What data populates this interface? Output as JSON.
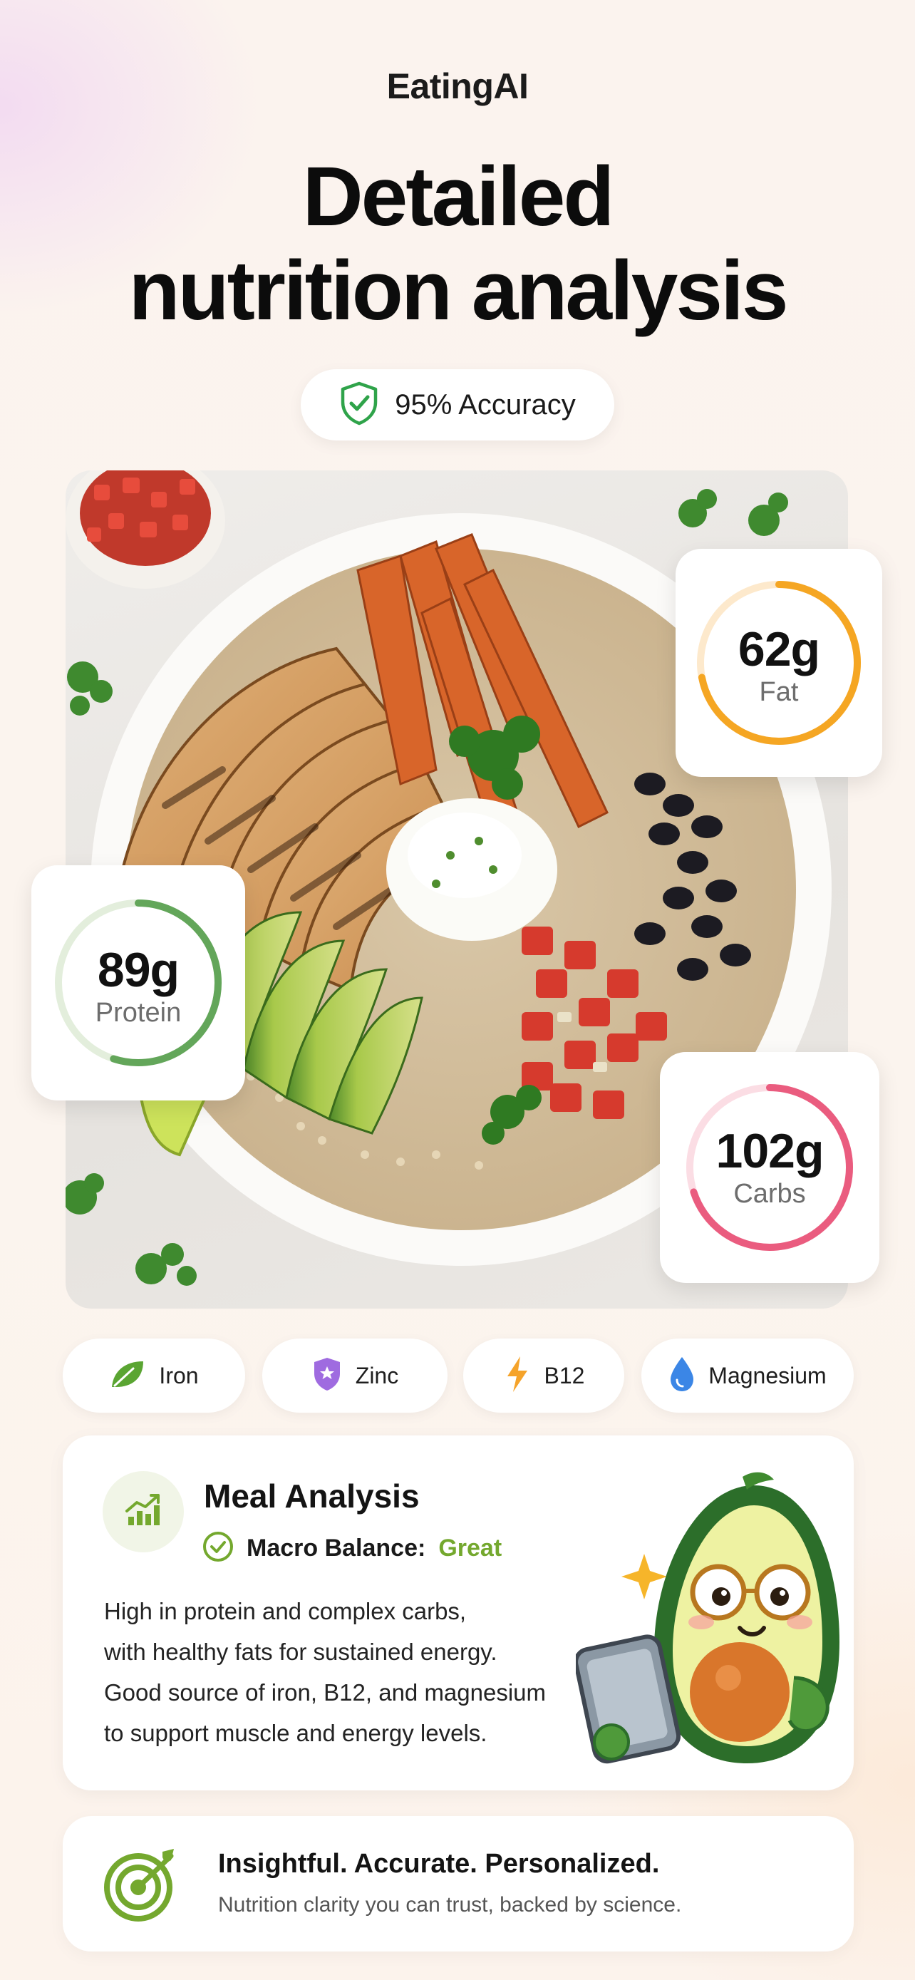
{
  "brand": "EatingAI",
  "headline": {
    "line1": "Detailed",
    "line2": "nutrition analysis"
  },
  "accuracy": {
    "label": "95% Accuracy",
    "icon": "shield-check-icon",
    "color": "#2fa34a"
  },
  "macros": {
    "fat": {
      "value": "62g",
      "label": "Fat",
      "color": "#f5a623",
      "progress": 0.72
    },
    "protein": {
      "value": "89g",
      "label": "Protein",
      "color": "#63a65a",
      "progress": 0.55
    },
    "carbs": {
      "value": "102g",
      "label": "Carbs",
      "color": "#ea5c7f",
      "progress": 0.7
    }
  },
  "nutrients": [
    {
      "label": "Iron",
      "icon": "leaf-icon",
      "color": "#5aa532"
    },
    {
      "label": "Zinc",
      "icon": "star-shield-icon",
      "color": "#9f6be0"
    },
    {
      "label": "B12",
      "icon": "lightning-icon",
      "color": "#f5a32a"
    },
    {
      "label": "Magnesium",
      "icon": "droplet-icon",
      "color": "#3b86e6"
    }
  ],
  "analysis": {
    "title": "Meal Analysis",
    "macro_balance_label": "Macro Balance:",
    "macro_balance_value": "Great",
    "accent": "#74a82e",
    "lines": [
      "High in protein and complex carbs,",
      "with healthy fats for sustained energy.",
      "Good source of iron, B12, and magnesium",
      "to support muscle and energy levels."
    ]
  },
  "footer": {
    "title": "Insightful. Accurate. Personalized.",
    "subtitle": "Nutrition clarity you can trust, backed by science."
  }
}
